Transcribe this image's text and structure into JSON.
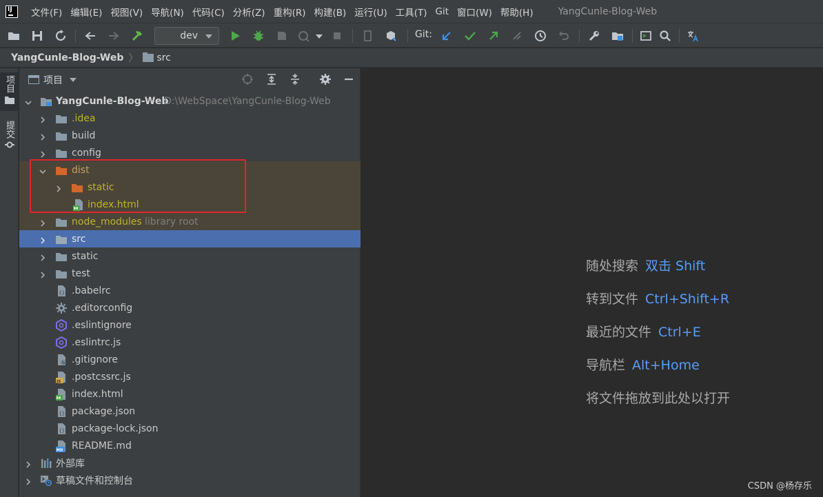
{
  "menu": {
    "items": [
      "文件(F)",
      "编辑(E)",
      "视图(V)",
      "导航(N)",
      "代码(C)",
      "分析(Z)",
      "重构(R)",
      "构建(B)",
      "运行(U)",
      "工具(T)",
      "Git",
      "窗口(W)",
      "帮助(H)"
    ],
    "window_title": "YangCunle-Blog-Web"
  },
  "toolbar": {
    "branch": "dev",
    "git_label": "Git:"
  },
  "breadcrumb": {
    "root": "YangCunle-Blog-Web",
    "sep": "〉",
    "child": "src"
  },
  "left_strip": {
    "project_tab": "项目",
    "commit_tab": "提交"
  },
  "project_panel": {
    "title": "项目",
    "tree": {
      "root_name": "YangCunle-Blog-Web",
      "root_path": "D:\\WebSpace\\YangCunle-Blog-Web",
      "items": [
        {
          "label": ".idea"
        },
        {
          "label": "build"
        },
        {
          "label": "config"
        },
        {
          "label": "dist"
        },
        {
          "label": "static"
        },
        {
          "label": "index.html"
        },
        {
          "label": "node_modules",
          "hint": "library root"
        },
        {
          "label": "src"
        },
        {
          "label": "static"
        },
        {
          "label": "test"
        },
        {
          "label": ".babelrc"
        },
        {
          "label": ".editorconfig"
        },
        {
          "label": ".eslintignore"
        },
        {
          "label": ".eslintrc.js"
        },
        {
          "label": ".gitignore"
        },
        {
          "label": ".postcssrc.js"
        },
        {
          "label": "index.html"
        },
        {
          "label": "package.json"
        },
        {
          "label": "package-lock.json"
        },
        {
          "label": "README.md"
        },
        {
          "label": "外部库"
        },
        {
          "label": "草稿文件和控制台"
        }
      ]
    }
  },
  "editor": {
    "shortcuts": [
      {
        "label": "随处搜索",
        "key": "双击 Shift"
      },
      {
        "label": "转到文件",
        "key": "Ctrl+Shift+R"
      },
      {
        "label": "最近的文件",
        "key": "Ctrl+E"
      },
      {
        "label": "导航栏",
        "key": "Alt+Home"
      },
      {
        "label": "将文件拖放到此处以打开",
        "key": ""
      }
    ]
  },
  "watermark": "CSDN @杨存乐",
  "colors": {
    "selection": "#4b6eaf",
    "excluded_bg": "#4b4539",
    "highlight_box": "#e0262a",
    "shortcut_key": "#589df6"
  }
}
